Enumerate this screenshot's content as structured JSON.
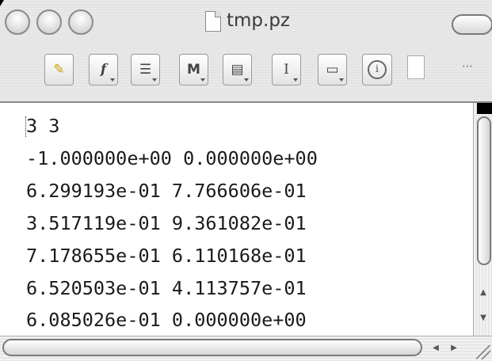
{
  "window": {
    "title": "tmp.pz"
  },
  "toolbar": {
    "buttons": [
      {
        "icon": "pencil-icon",
        "glyph": "✎"
      },
      {
        "icon": "function-icon",
        "glyph": "f"
      },
      {
        "icon": "list-icon",
        "glyph": "☰"
      },
      {
        "icon": "marker-icon",
        "glyph": "M"
      },
      {
        "icon": "document-icon",
        "glyph": "▤"
      },
      {
        "icon": "text-cursor-icon",
        "glyph": "I"
      },
      {
        "icon": "folder-icon",
        "glyph": "▭"
      }
    ],
    "info_glyph": "i",
    "more_glyph": "⋯"
  },
  "content": {
    "lines": [
      "3 3",
      "-1.000000e+00 0.000000e+00",
      "6.299193e-01 7.766606e-01",
      "3.517119e-01 9.361082e-01",
      "7.178655e-01 6.110168e-01",
      "6.520503e-01 4.113757e-01",
      "6.085026e-01 0.000000e+00"
    ]
  },
  "scroll_arrows": {
    "up": "▲",
    "down": "▼",
    "left": "◀",
    "right": "▶"
  }
}
